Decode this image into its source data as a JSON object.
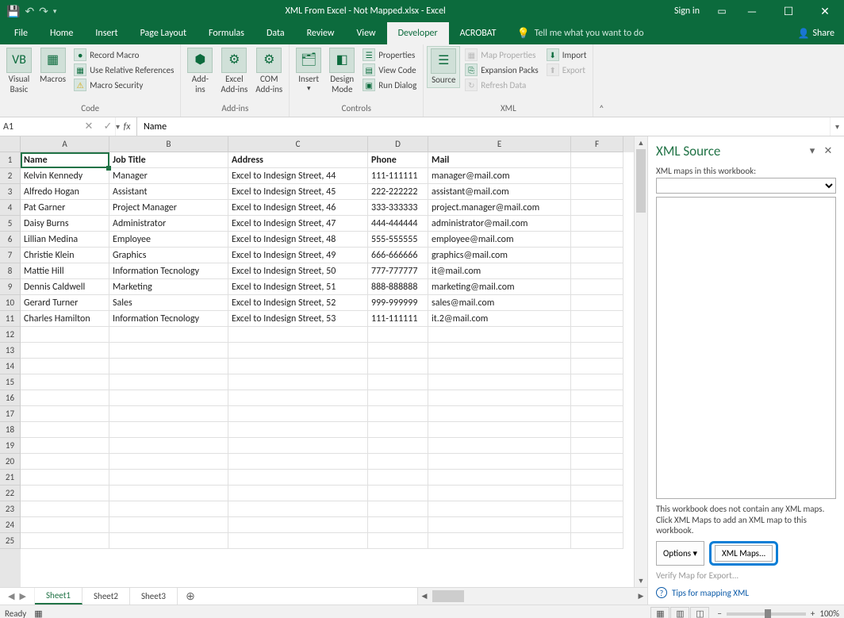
{
  "titlebar": {
    "doc_title": "XML From Excel - Not Mapped.xlsx - Excel",
    "sign_in": "Sign in"
  },
  "tabs": {
    "file": "File",
    "items": [
      "Home",
      "Insert",
      "Page Layout",
      "Formulas",
      "Data",
      "Review",
      "View",
      "Developer",
      "ACROBAT"
    ],
    "active": "Developer",
    "tell_me": "Tell me what you want to do",
    "share": "Share"
  },
  "ribbon": {
    "group_code": {
      "label": "Code",
      "visual_basic": "Visual\nBasic",
      "macros": "Macros",
      "record_macro": "Record Macro",
      "use_rel_refs": "Use Relative References",
      "macro_security": "Macro Security"
    },
    "group_addins": {
      "label": "Add-ins",
      "addins": "Add-\nins",
      "excel_addins": "Excel\nAdd-ins",
      "com_addins": "COM\nAdd-ins"
    },
    "group_controls": {
      "label": "Controls",
      "insert": "Insert",
      "design_mode": "Design\nMode",
      "properties": "Properties",
      "view_code": "View Code",
      "run_dialog": "Run Dialog"
    },
    "group_xml": {
      "label": "XML",
      "source": "Source",
      "map_properties": "Map Properties",
      "expansion_packs": "Expansion Packs",
      "refresh_data": "Refresh Data",
      "import": "Import",
      "export": "Export"
    }
  },
  "formula_bar": {
    "name_box": "A1",
    "formula": "Name"
  },
  "columns": [
    "A",
    "B",
    "C",
    "D",
    "E",
    "F"
  ],
  "headers": [
    "Name",
    "Job Title",
    "Address",
    "Phone",
    "Mail"
  ],
  "rows": [
    [
      "Kelvin Kennedy",
      "Manager",
      "Excel to Indesign Street, 44",
      "111-111111",
      "manager@mail.com"
    ],
    [
      "Alfredo Hogan",
      "Assistant",
      "Excel to Indesign Street, 45",
      "222-222222",
      "assistant@mail.com"
    ],
    [
      "Pat Garner",
      "Project Manager",
      "Excel to Indesign Street, 46",
      "333-333333",
      "project.manager@mail.com"
    ],
    [
      "Daisy Burns",
      "Administrator",
      "Excel to Indesign Street, 47",
      "444-444444",
      "administrator@mail.com"
    ],
    [
      "Lillian Medina",
      "Employee",
      "Excel to Indesign Street, 48",
      "555-555555",
      "employee@mail.com"
    ],
    [
      "Christie Klein",
      "Graphics",
      "Excel to Indesign Street, 49",
      "666-666666",
      "graphics@mail.com"
    ],
    [
      "Mattie Hill",
      "Information Tecnology",
      "Excel to Indesign Street, 50",
      "777-777777",
      "it@mail.com"
    ],
    [
      "Dennis Caldwell",
      "Marketing",
      "Excel to Indesign Street, 51",
      "888-888888",
      "marketing@mail.com"
    ],
    [
      "Gerard Turner",
      "Sales",
      "Excel to Indesign Street, 52",
      "999-999999",
      "sales@mail.com"
    ],
    [
      "Charles Hamilton",
      "Information Tecnology",
      "Excel to Indesign Street, 53",
      "111-111111",
      "it.2@mail.com"
    ]
  ],
  "total_visible_rows": 25,
  "sheet_tabs": {
    "items": [
      "Sheet1",
      "Sheet2",
      "Sheet3"
    ],
    "active": "Sheet1"
  },
  "taskpane": {
    "title": "XML Source",
    "maps_label": "XML maps in this workbook:",
    "msg": "This workbook does not contain any XML maps. Click XML Maps to add an XML map to this workbook.",
    "options_btn": "Options ▾",
    "xml_maps_btn": "XML Maps...",
    "verify": "Verify Map for Export...",
    "tips": "Tips for mapping XML"
  },
  "statusbar": {
    "ready": "Ready",
    "zoom": "100%"
  }
}
